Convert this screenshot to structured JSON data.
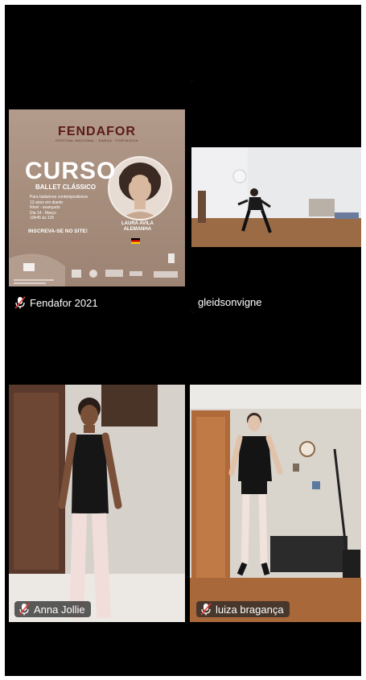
{
  "participants": [
    {
      "name": "Fendafor 2021",
      "muted": true
    },
    {
      "name": "gleidsonvigne",
      "muted": false,
      "active_speaker": true
    },
    {
      "name": "Anna Jollie",
      "muted": true
    },
    {
      "name": "luiza bragança",
      "muted": true
    }
  ],
  "poster": {
    "logo": "FENDAFOR",
    "logo_sub": "FESTIVAL NACIONAL · DANÇA · FORTALEZA",
    "title": "CURSO",
    "subtitle": "BALLET CLÁSSICO",
    "info": [
      "Para bailarinos contemporâneos",
      "13 anos em diante",
      "Nível - avançado",
      "Dia 14 - Março",
      "10h45 às 12h"
    ],
    "cta": "INSCREVA-SE NO SITE!",
    "teacher_line1": "LAURA AVILA",
    "teacher_line2": "ALEMANHA"
  },
  "colors": {
    "background": "#000000",
    "active_border": "#3ec46a",
    "poster_bg": "#a88f7f",
    "logo": "#5a1a1a"
  },
  "icons": {
    "muted": "mic-off-icon"
  }
}
